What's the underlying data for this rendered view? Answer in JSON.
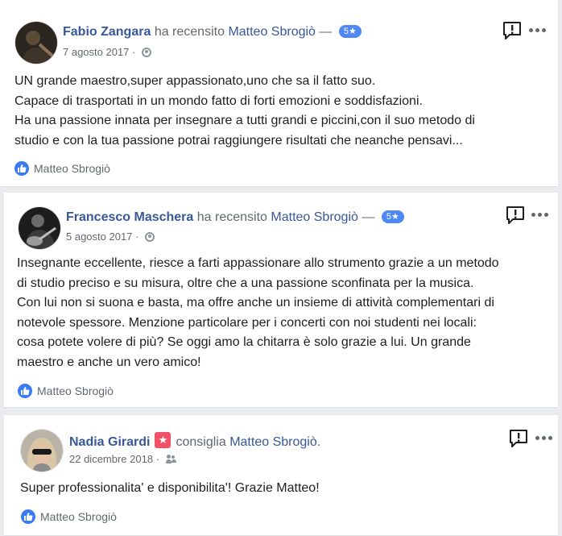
{
  "reviews": [
    {
      "author": "Fabio Zangara",
      "verb": "ha recensito",
      "page": "Matteo Sbrogiò",
      "suffix": " —",
      "rating_badge": "5★",
      "date": "7 agosto 2017",
      "privacy_icon": "globe-icon",
      "text": "UN grande maestro,super appassionato,uno che sa il fatto suo.\nCapace di trasportati in un mondo fatto di forti emozioni e soddisfazioni.\nHa una passione innata per insegnare a tutti grandi e piccini,con il suo metodo di\nstudio e con la tua passione potrai raggiungere risultati che neanche pensavi...",
      "liked_by": "Matteo Sbrogiò"
    },
    {
      "author": "Francesco Maschera",
      "verb": "ha recensito",
      "page": "Matteo Sbrogiò",
      "suffix": " —",
      "rating_badge": "5★",
      "date": "5 agosto 2017",
      "privacy_icon": "globe-icon",
      "text": "Insegnante eccellente, riesce a farti appassionare allo strumento grazie a un metodo\ndi studio preciso e su misura, oltre che a una passione sconfinata per la musica.\nCon lui non si suona e basta, ma offre anche un insieme di attività complementari di\nnotevole spessore. Menzione particolare per i concerti con noi studenti nei locali:\ncosa potete volere di più? Se oggi amo la chitarra è solo grazie a lui. Un grande\nmaestro e anche un vero amico!",
      "liked_by": "Matteo Sbrogiò"
    },
    {
      "author": "Nadia Girardi",
      "verb": "consiglia",
      "page": "Matteo Sbrogiò",
      "suffix": ".",
      "recommend_icon": "recommend-star-icon",
      "date": "22 dicembre 2018",
      "privacy_icon": "friends-icon",
      "text": "Super professionalita' e disponibilita'! Grazie Matteo!",
      "liked_by": "Matteo Sbrogiò"
    }
  ],
  "colors": {
    "link": "#385898",
    "badge": "#4e88f2",
    "recommend": "#f25268",
    "like": "#3b7bf0",
    "background": "#e9ebee"
  }
}
